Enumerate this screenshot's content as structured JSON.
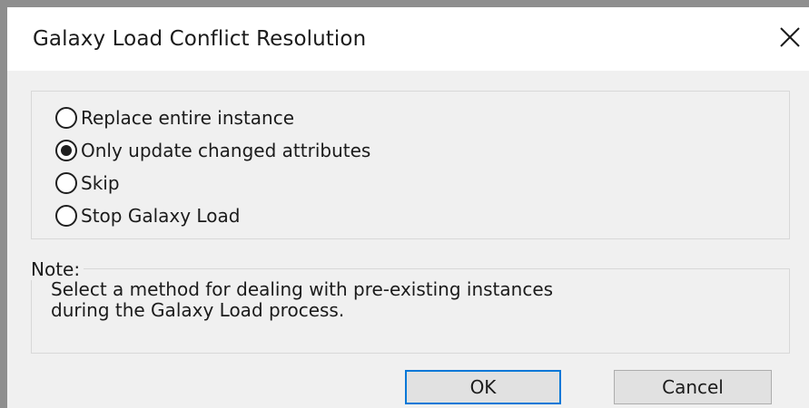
{
  "dialog": {
    "title": "Galaxy Load Conflict Resolution",
    "close_icon": "close-icon"
  },
  "options": [
    {
      "label": "Replace entire instance",
      "selected": false
    },
    {
      "label": "Only update changed attributes",
      "selected": true
    },
    {
      "label": "Skip",
      "selected": false
    },
    {
      "label": "Stop Galaxy Load",
      "selected": false
    }
  ],
  "note": {
    "legend": "Note:",
    "line1": "Select a method for dealing with pre-existing instances",
    "line2": "during the Galaxy Load process."
  },
  "buttons": {
    "ok": "OK",
    "cancel": "Cancel"
  },
  "colors": {
    "accent": "#0078d7",
    "dialog_bg": "#f0f0f0",
    "titlebar_bg": "#ffffff"
  }
}
